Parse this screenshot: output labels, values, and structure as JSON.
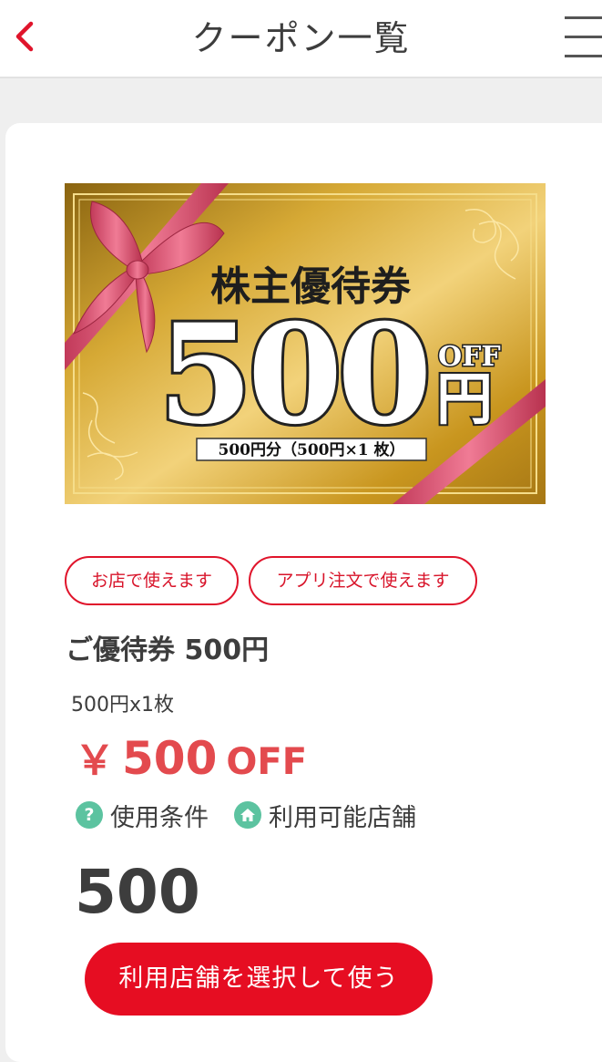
{
  "header": {
    "title": "クーポン一覧",
    "back_icon": "chevron-left-icon",
    "menu_icon": "hamburger-menu-icon"
  },
  "banner": {
    "heading": "株主優待券",
    "amount": "500",
    "unit": "円",
    "off": "OFF",
    "detail": "500円分（500円×1 枚）"
  },
  "tags": [
    "お店で使えます",
    "アプリ注文で使えます"
  ],
  "coupon": {
    "title": "ご優待券 500円",
    "sub": "500円x1枚",
    "discount_yen": "￥",
    "discount_amount": "500",
    "discount_off": "OFF"
  },
  "links": {
    "terms": "使用条件",
    "terms_icon": "question-icon",
    "stores": "利用可能店舗",
    "stores_icon": "home-icon"
  },
  "quantity": "500",
  "action_button": "利用店舗を選択して使う",
  "colors": {
    "accent_red": "#e60d22",
    "discount_red": "#e34a4e",
    "icon_green": "#5cc3a0",
    "gold": "#c99a22"
  }
}
